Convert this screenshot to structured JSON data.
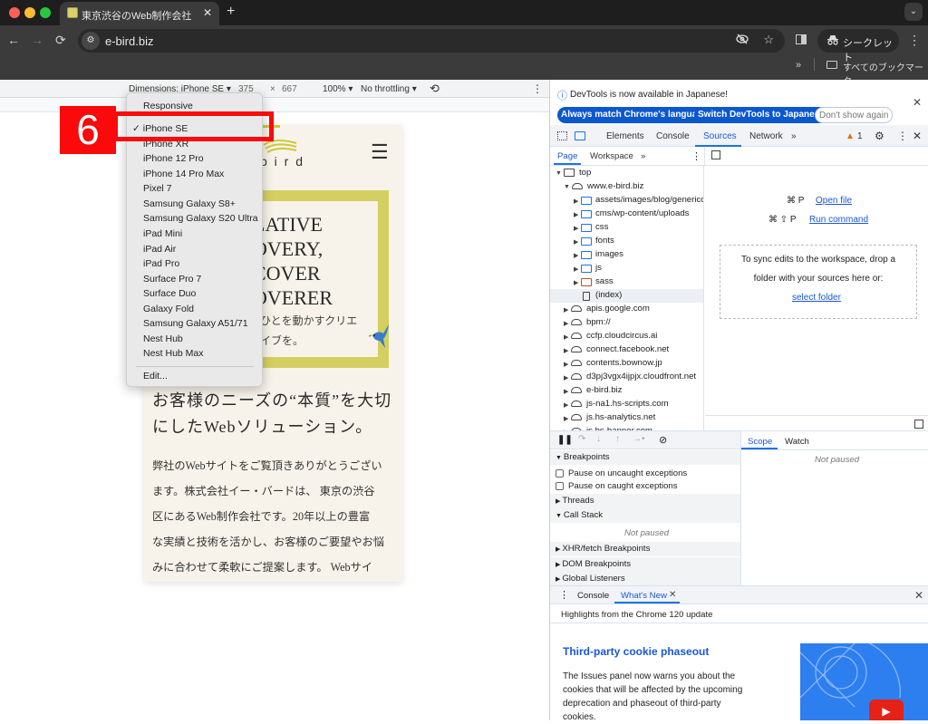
{
  "browser": {
    "tab_title": "東京渋谷のWeb制作会社｜BtoB",
    "tab_close": "✕",
    "new_tab": "+",
    "tab_menu": "⌄",
    "nav": {
      "back": "←",
      "forward": "→",
      "reload": "⟳"
    },
    "url": "e-bird.biz",
    "site_info_icon": "⚙",
    "eye_icon": "👁",
    "star_icon": "☆",
    "incognito_label": "シークレット",
    "incognito_icon": "🕵",
    "menu_icon": "⋮",
    "bookmarks_overflow": "»",
    "bookmarks_all": "すべてのブックマーク"
  },
  "device_toolbar": {
    "dimensions_label": "Dimensions: iPhone SE ▾",
    "width": "375",
    "times": "×",
    "height": "667",
    "zoom": "100% ▾",
    "throttling": "No throttling ▾",
    "rotate_icon": "⟲",
    "more_icon": "⋮"
  },
  "device_menu": {
    "items": [
      "Responsive",
      "iPhone SE",
      "iPhone XR",
      "iPhone 12 Pro",
      "iPhone 14 Pro Max",
      "Pixel 7",
      "Samsung Galaxy S8+",
      "Samsung Galaxy S20 Ultra",
      "iPad Mini",
      "iPad Air",
      "iPad Pro",
      "Surface Pro 7",
      "Surface Duo",
      "Galaxy Fold",
      "Samsung Galaxy A51/71",
      "Nest Hub",
      "Nest Hub Max"
    ],
    "selected": "iPhone SE",
    "checkmark": "✓",
    "edit": "Edit..."
  },
  "callout": {
    "number": "6",
    "color": "#fa0a0a"
  },
  "site": {
    "logo_text": "b i r d",
    "menu_icon": "☰",
    "hero_lines": [
      "LATIVE",
      "OVERY,",
      "COVER",
      "OVERER"
    ],
    "hero_sub": [
      "ひとを動かすクリエ",
      "イブを。"
    ],
    "heading": [
      "お客様のニーズの“本質”を大切",
      "にしたWebソリューション。"
    ],
    "body": [
      "弊社のWebサイトをご覧頂きありがとうござい",
      "ます。株式会社イー・バードは、 東京の渋谷",
      "区にあるWeb制作会社です。20年以上の豊富",
      "な実績と技術を活かし、お客様のご要望やお悩",
      "みに合わせて柔軟にご提案します。 Webサイ"
    ],
    "accent": "#d3cf60"
  },
  "devtools": {
    "banner": {
      "info_icon": "ⓘ",
      "text": "DevTools is now available in Japanese!",
      "btn_match": "Always match Chrome's language",
      "btn_switch": "Switch DevTools to Japanese",
      "btn_dont": "Don't show again",
      "close": "✕"
    },
    "tabs": {
      "elements": "Elements",
      "console": "Console",
      "sources": "Sources",
      "network": "Network",
      "more": "»",
      "warn_count": "1",
      "warn_icon": "▲",
      "gear": "⚙",
      "kebab": "⋮",
      "close": "✕"
    },
    "nav_tabs": {
      "page": "Page",
      "workspace": "Workspace",
      "more": "»",
      "kebab": "⋮"
    },
    "tree": {
      "top": "top",
      "origin": "www.e-bird.biz",
      "folders": [
        "assets/images/blog/genericon",
        "cms/wp-content/uploads",
        "css",
        "fonts",
        "images",
        "js",
        "sass"
      ],
      "index": "(index)",
      "domains": [
        "apis.google.com",
        "bpm://",
        "ccfp.cloudcircus.ai",
        "connect.facebook.net",
        "contents.bownow.jp",
        "d3pj3vgx4ijpjx.cloudfront.net",
        "e-bird.biz",
        "js-na1.hs-scripts.com",
        "js.hs-analytics.net",
        "js.hs-banner.com"
      ]
    },
    "editor": {
      "open_shortcut": "⌘ P",
      "open_label": "Open file",
      "run_shortcut": "⌘ ⇧ P",
      "run_label": "Run command",
      "drop_text_1": "To sync edits to the workspace, drop a",
      "drop_text_2": "folder with your sources here or:",
      "select_folder": "select folder"
    },
    "debugger": {
      "breakpoints": "Breakpoints",
      "pause_uncaught": "Pause on uncaught exceptions",
      "pause_caught": "Pause on caught exceptions",
      "threads": "Threads",
      "call_stack": "Call Stack",
      "not_paused": "Not paused",
      "xhr": "XHR/fetch Breakpoints",
      "dom": "DOM Breakpoints",
      "global": "Global Listeners",
      "scope": "Scope",
      "watch": "Watch"
    },
    "drawer": {
      "kebab": "⋮",
      "console": "Console",
      "whats_new": "What's New",
      "close_tab": "✕",
      "close": "✕",
      "highlights": "Highlights from the Chrome 120 update",
      "title": "Third-party cookie phaseout",
      "body": [
        "The Issues panel now warns you about the",
        "cookies that will be affected by the upcoming",
        "deprecation and phaseout of third-party",
        "cookies."
      ],
      "play_icon": "▶"
    }
  }
}
